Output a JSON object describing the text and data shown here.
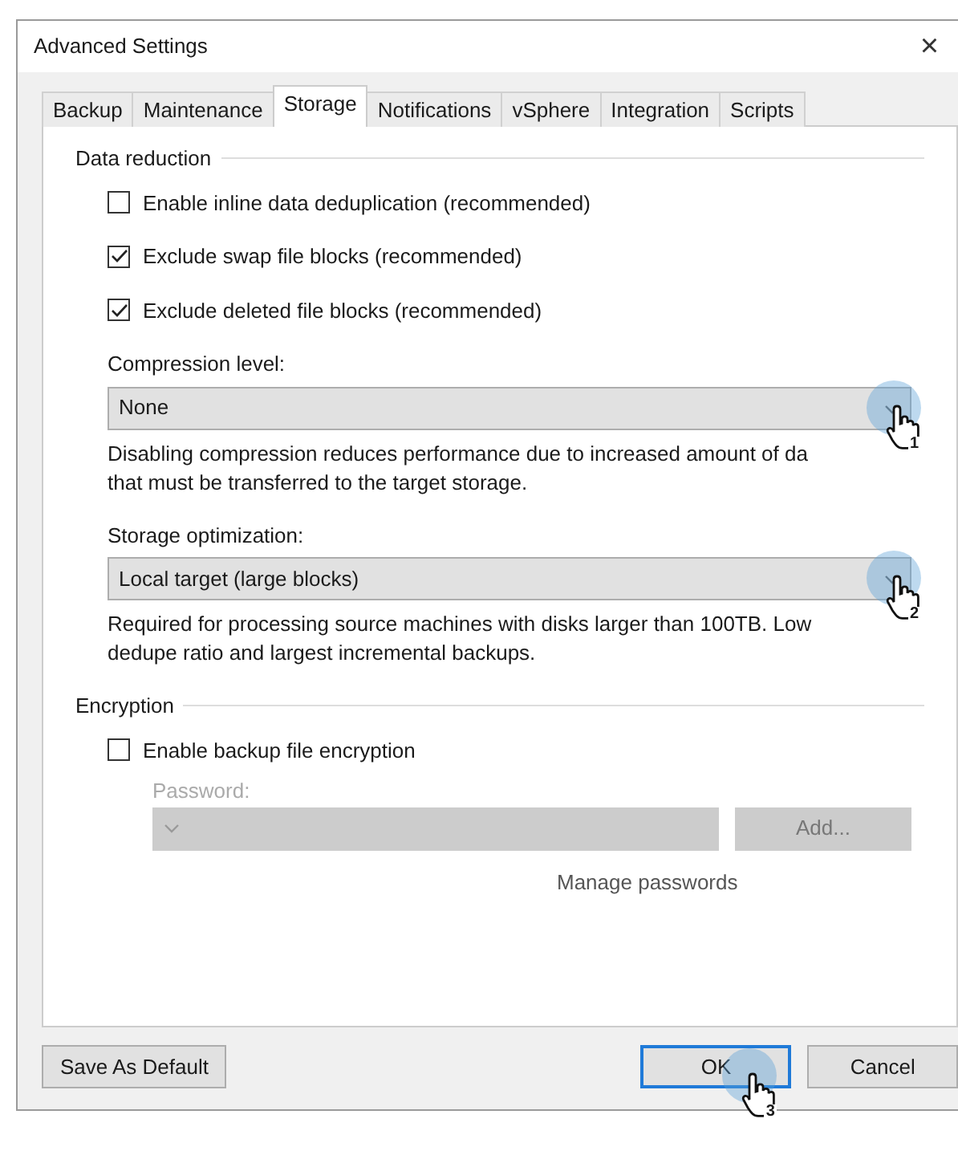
{
  "window": {
    "title": "Advanced Settings",
    "close": "×"
  },
  "tabs": [
    {
      "label": "Backup",
      "selected": false
    },
    {
      "label": "Maintenance",
      "selected": false
    },
    {
      "label": "Storage",
      "selected": true
    },
    {
      "label": "Notifications",
      "selected": false
    },
    {
      "label": "vSphere",
      "selected": false
    },
    {
      "label": "Integration",
      "selected": false
    },
    {
      "label": "Scripts",
      "selected": false
    }
  ],
  "data_reduction": {
    "title": "Data reduction",
    "checkboxes": [
      {
        "label": "Enable inline data deduplication (recommended)",
        "checked": false
      },
      {
        "label": "Exclude swap file blocks (recommended)",
        "checked": true
      },
      {
        "label": "Exclude deleted file blocks (recommended)",
        "checked": true
      }
    ],
    "dropdowns": [
      {
        "label": "Compression level:",
        "value": "None",
        "description": "Disabling compression reduces performance due to increased amount of da\nthat must be transferred to the target storage.",
        "step": "1"
      },
      {
        "label": "Storage optimization:",
        "value": "Local target (large blocks)",
        "description": "Required for processing source machines with disks larger than 100TB. Low\ndedupe ratio and largest incremental backups.",
        "step": "2"
      }
    ]
  },
  "encryption": {
    "title": "Encryption",
    "checkbox": {
      "label": "Enable backup file encryption",
      "checked": false
    },
    "password": {
      "label": "Password:",
      "disabled": true
    },
    "add_button": {
      "label": "Add...",
      "disabled": true
    },
    "manage_link": "Manage passwords"
  },
  "buttons": [
    {
      "label": "Save As Default",
      "default": false
    },
    {
      "label": "OK",
      "default": true,
      "step": "3"
    },
    {
      "label": "Cancel",
      "default": false
    }
  ]
}
